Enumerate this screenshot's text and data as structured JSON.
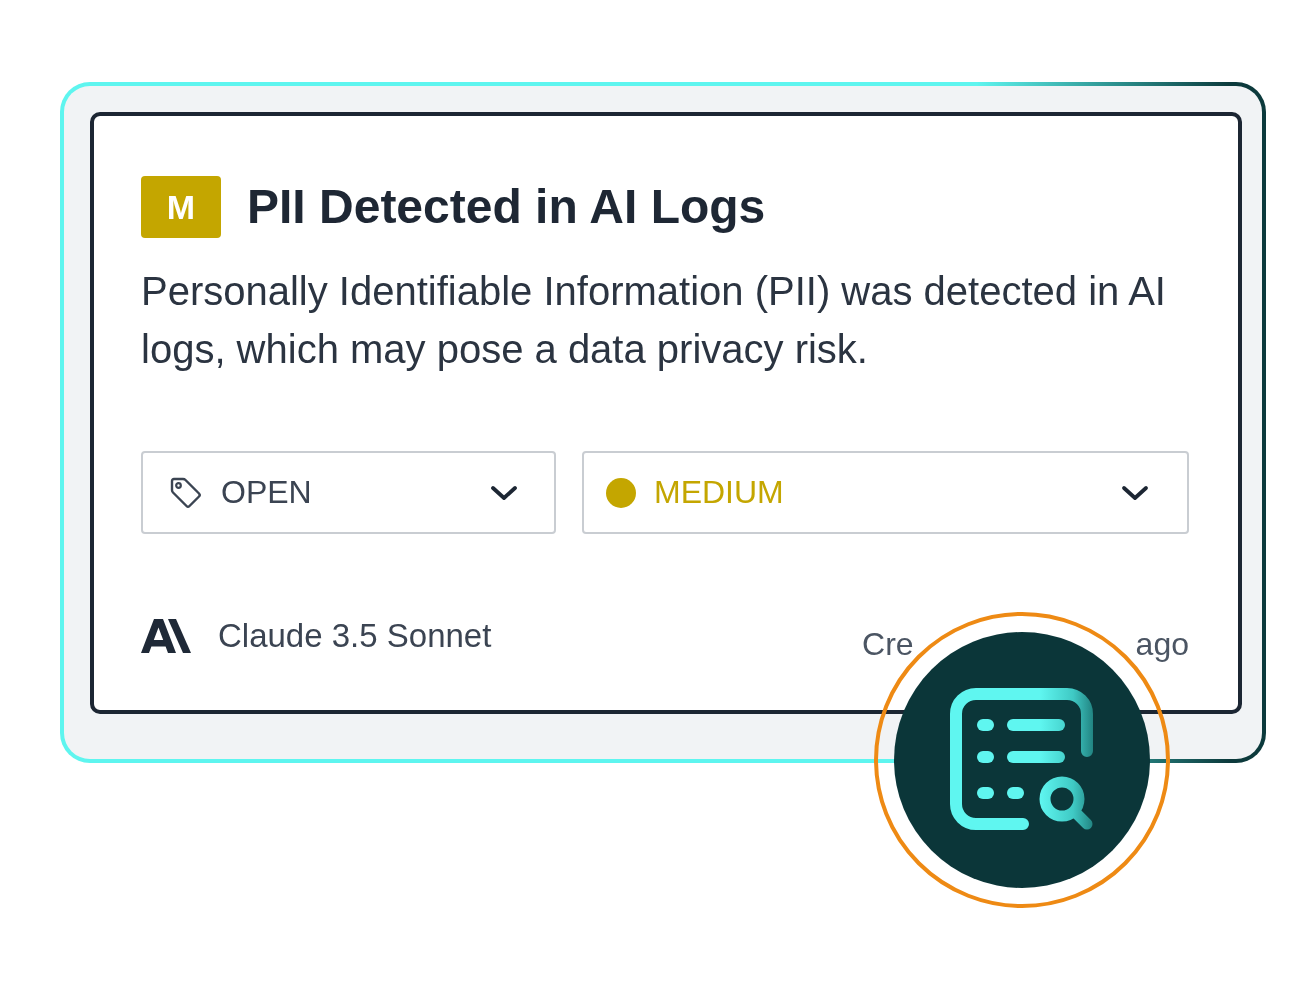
{
  "alert": {
    "badge": "M",
    "title": "PII Detected in AI Logs",
    "description": "Personally Identifiable Information (PII) was detected in AI logs, which may pose a data privacy risk."
  },
  "selects": [
    {
      "kind": "status",
      "value": "OPEN"
    },
    {
      "kind": "severity",
      "value": "MEDIUM",
      "color": "#c4a600"
    }
  ],
  "footer": {
    "model": "Claude 3.5 Sonnet",
    "timestamp_fragments": [
      "Cre",
      "ago"
    ]
  }
}
